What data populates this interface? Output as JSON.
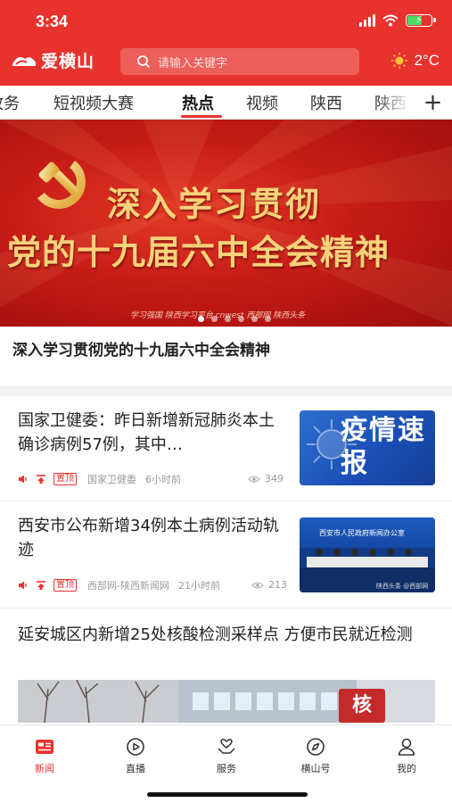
{
  "status_bar": {
    "time": "3:34"
  },
  "header": {
    "logo_text": "爱横山",
    "search_placeholder": "请输入关键字",
    "weather": {
      "temperature": "2°C",
      "icon": "sun-icon"
    },
    "accent_color": "#e8322d"
  },
  "tabs": {
    "items": [
      {
        "label": "政务"
      },
      {
        "label": "短视频大赛"
      },
      {
        "label": "热点"
      },
      {
        "label": "视频"
      },
      {
        "label": "陕西"
      },
      {
        "label": "陕西"
      }
    ],
    "active_index": 2,
    "add_label": "+"
  },
  "banner": {
    "line1": "深入学习贯彻",
    "line2": "党的十九届六中全会精神",
    "logos_text": "学习强国 陕西学习平台  cnwest 西部网 陕西头条",
    "caption": "深入学习贯彻党的十九届六中全会精神",
    "slide_count": 6,
    "active_slide": 0
  },
  "news": [
    {
      "title": "国家卫健委：昨日新增新冠肺炎本土确诊病例57例，其中…",
      "badge": "置顶",
      "source": "国家卫健委",
      "time": "6小时前",
      "views": "349",
      "thumb_text": "疫情速报"
    },
    {
      "title": "西安市公布新增34例本土病例活动轨迹",
      "badge": "置顶",
      "source": "西部网-陕西新闻网",
      "time": "21小时前",
      "views": "213",
      "thumb_sign": "西安市人民政府新闻办公室",
      "thumb_caption": "陕西头条 @西部网"
    },
    {
      "title": "延安城区内新增25处核酸检测采样点 方便市民就近检测",
      "image_sign": "核"
    }
  ],
  "bottom_nav": {
    "items": [
      {
        "label": "新闻",
        "icon": "newspaper-icon"
      },
      {
        "label": "直播",
        "icon": "play-icon"
      },
      {
        "label": "服务",
        "icon": "heart-hand-icon"
      },
      {
        "label": "横山号",
        "icon": "compass-icon"
      },
      {
        "label": "我的",
        "icon": "user-icon"
      }
    ],
    "active_index": 0
  }
}
